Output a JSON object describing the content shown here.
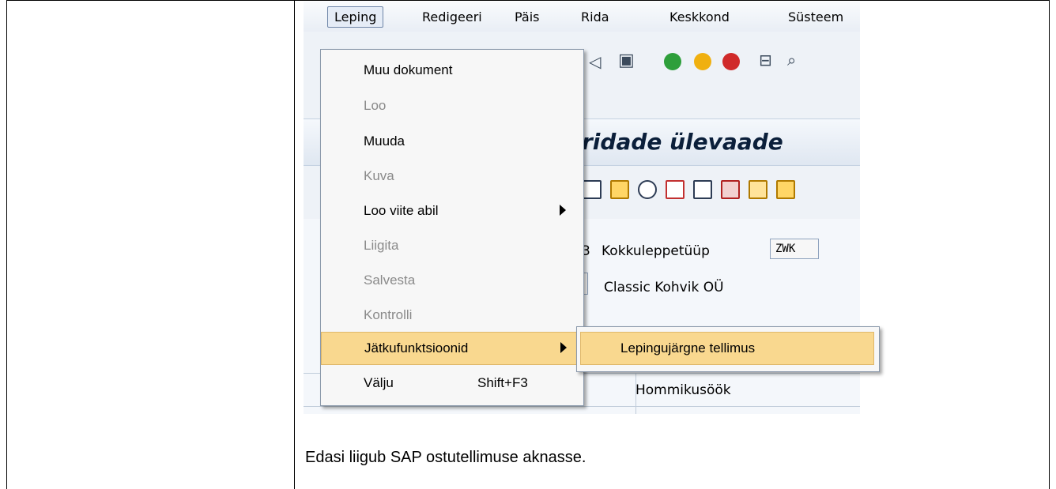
{
  "menubar": {
    "items": [
      {
        "label": "Leping",
        "accel": "L"
      },
      {
        "label": "Redigeeri",
        "accel": "R"
      },
      {
        "label": "Päis",
        "accel": "P"
      },
      {
        "label": "Rida",
        "accel": "i"
      },
      {
        "label": "Keskkond",
        "accel": "K"
      },
      {
        "label": "Süsteem",
        "accel": "S"
      }
    ]
  },
  "title": {
    "text": "ridade ülevaade"
  },
  "form": {
    "agreement_type_label": "Kokkuleppetüüp",
    "agreement_type_value": "ZWK",
    "agreement_type_prefix": "3",
    "vendor_name": "Classic Kohvik OÜ",
    "row_text": "Hommikusöök"
  },
  "dropdown": {
    "items": [
      {
        "label": "Muu dokument",
        "state": "enabled"
      },
      {
        "label": "Loo",
        "state": "disabled"
      },
      {
        "label": "Muuda",
        "state": "enabled"
      },
      {
        "label": "Kuva",
        "state": "disabled"
      },
      {
        "label": "Loo viite abil",
        "state": "enabled",
        "submenu": true
      },
      {
        "label": "Liigita",
        "state": "disabled"
      },
      {
        "label": "Salvesta",
        "state": "disabled"
      },
      {
        "label": "Kontrolli",
        "state": "disabled"
      },
      {
        "label": "Jätkufunktsioonid",
        "state": "highlighted",
        "submenu": true
      },
      {
        "label": "Välju",
        "state": "enabled",
        "shortcut": "Shift+F3"
      }
    ]
  },
  "submenu": {
    "item": "Lepingujärgne tellimus"
  },
  "caption": "Edasi liigub SAP ostutellimuse aknasse.",
  "colors": {
    "highlight": "#f9d88f",
    "menu_bg": "#f7f7f7",
    "title_text": "#0b1f3a"
  }
}
